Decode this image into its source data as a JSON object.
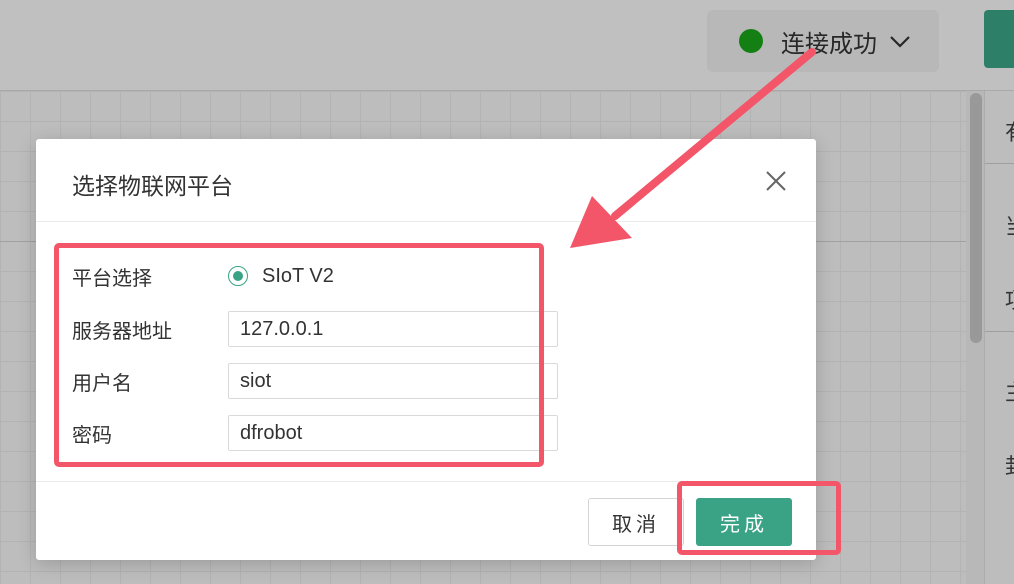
{
  "header": {
    "connection_status": "连接成功",
    "status_color": "#1aa51a"
  },
  "dialog": {
    "title": "选择物联网平台",
    "platform_label": "平台选择",
    "platform_option": "SIoT V2",
    "server_label": "服务器地址",
    "server_value": "127.0.0.1",
    "username_label": "用户名",
    "username_value": "siot",
    "password_label": "密码",
    "password_value": "dfrobot",
    "cancel_label": "取消",
    "done_label": "完成"
  },
  "side_panel": {
    "texts": [
      "有",
      "当",
      "项",
      "主",
      "封"
    ]
  },
  "colors": {
    "accent": "#3aa386",
    "annotation": "#f25668"
  }
}
